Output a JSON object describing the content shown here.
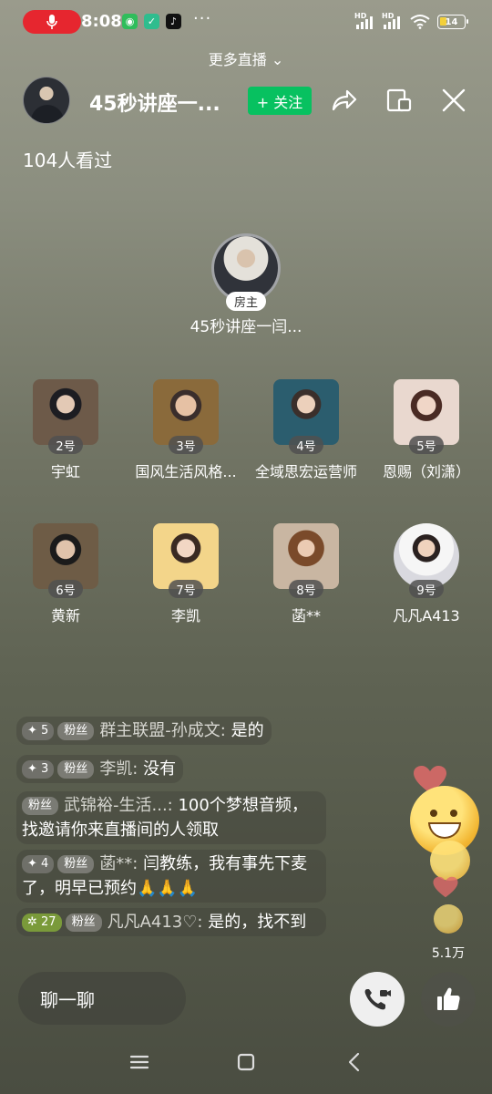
{
  "status_bar": {
    "time": "8:08",
    "dots": "···",
    "hd1": "HD",
    "hd2": "HD",
    "battery": "14"
  },
  "top": {
    "more_live": "更多直播 ⌄"
  },
  "header": {
    "room_title": "45秒讲座一...",
    "follow_label": "+ 关注"
  },
  "viewers": "104人看过",
  "owner": {
    "badge": "房主",
    "name": "45秒讲座一闫..."
  },
  "seats": [
    {
      "num": "2号",
      "name": "宇虹"
    },
    {
      "num": "3号",
      "name": "国风生活风格..."
    },
    {
      "num": "4号",
      "name": "全域思宏运营师"
    },
    {
      "num": "5号",
      "name": "恩赐（刘潇）"
    },
    {
      "num": "6号",
      "name": "黄新"
    },
    {
      "num": "7号",
      "name": "李凯"
    },
    {
      "num": "8号",
      "name": "菡**"
    },
    {
      "num": "9号",
      "name": "凡凡A413"
    }
  ],
  "comments": [
    {
      "level": "✦ 5",
      "fan": "粉丝",
      "name": "群主联盟-孙成文:",
      "text": " 是的"
    },
    {
      "level": "✦ 3",
      "fan": "粉丝",
      "name": "李凯:",
      "text": " 没有"
    },
    {
      "level": "",
      "fan": "粉丝",
      "name": "武锦裕-生活...:",
      "text": " 100个梦想音频，找邀请你来直播间的人领取"
    },
    {
      "level": "✦ 4",
      "fan": "粉丝",
      "name": "菡**:",
      "text": " 闫教练，我有事先下麦了，明早已预约🙏🙏🙏"
    },
    {
      "level": "✲ 27",
      "fan": "粉丝",
      "name": "凡凡A413♡:",
      "text": " 是的，找不到"
    }
  ],
  "likes": "5.1万",
  "bottom": {
    "chat_placeholder": "聊一聊"
  },
  "colors": {
    "follow": "#07c160",
    "mic": "#e6262f",
    "level_green": "#7a9a3a"
  }
}
